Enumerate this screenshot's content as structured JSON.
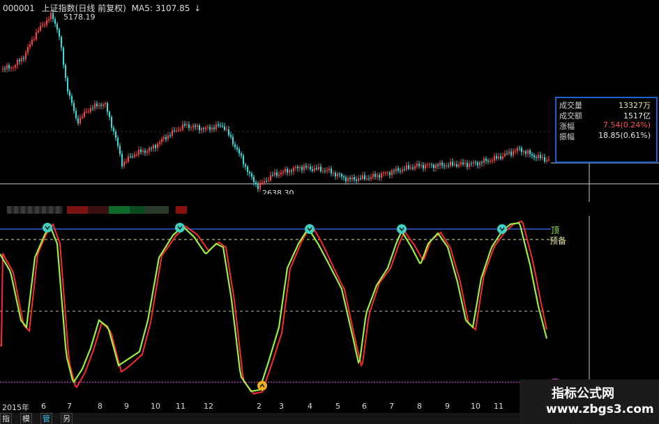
{
  "header": {
    "code": "000001",
    "name": "上证指数(日线 前复权)",
    "ma_label": "MA5: 3107.85",
    "arrow": "↓"
  },
  "price_chart": {
    "peak_label": "5178.19",
    "low_label": "2638.30",
    "colors": {
      "up": "#ff4040",
      "down": "#30e0e0",
      "background": "#000000"
    }
  },
  "info_panel": {
    "rows": [
      {
        "label": "成交量",
        "value": "13327万",
        "color": "#e8e8a0"
      },
      {
        "label": "成交额",
        "value": "1517亿",
        "color": "#e8e8e8"
      },
      {
        "label": "涨幅",
        "value": "7.54(0.24%)",
        "color": "#ff5050"
      },
      {
        "label": "振幅",
        "value": "18.85(0.61%)",
        "color": "#e8e8e8"
      }
    ],
    "border_color": "#1f5fd0"
  },
  "indicator": {
    "levels": {
      "top": "顶",
      "ready": "预备",
      "bottom": "底"
    },
    "colors": {
      "fast": "#ff2a2a",
      "slow": "#9cf040",
      "top_line": "#2f5fe0",
      "ready_line": "#e8e89a",
      "mid_line": "#cccccc",
      "bottom_line": "#d040d0",
      "top_marker": "#40d0c0",
      "bottom_marker": "#f0b020"
    }
  },
  "x_axis": {
    "labels": [
      "2015年",
      "6",
      "7",
      "8",
      "9",
      "10",
      "11",
      "12",
      "2",
      "3",
      "4",
      "5",
      "6",
      "7",
      "8",
      "9",
      "10",
      "11"
    ]
  },
  "tabs": [
    {
      "label": "指标",
      "active": false
    },
    {
      "label": "模板",
      "active": false
    },
    {
      "label": "管理",
      "active": true
    },
    {
      "label": "另存为",
      "active": false
    }
  ],
  "watermark": {
    "title": "指标公式网",
    "url": "www.zbgs3.com"
  }
}
